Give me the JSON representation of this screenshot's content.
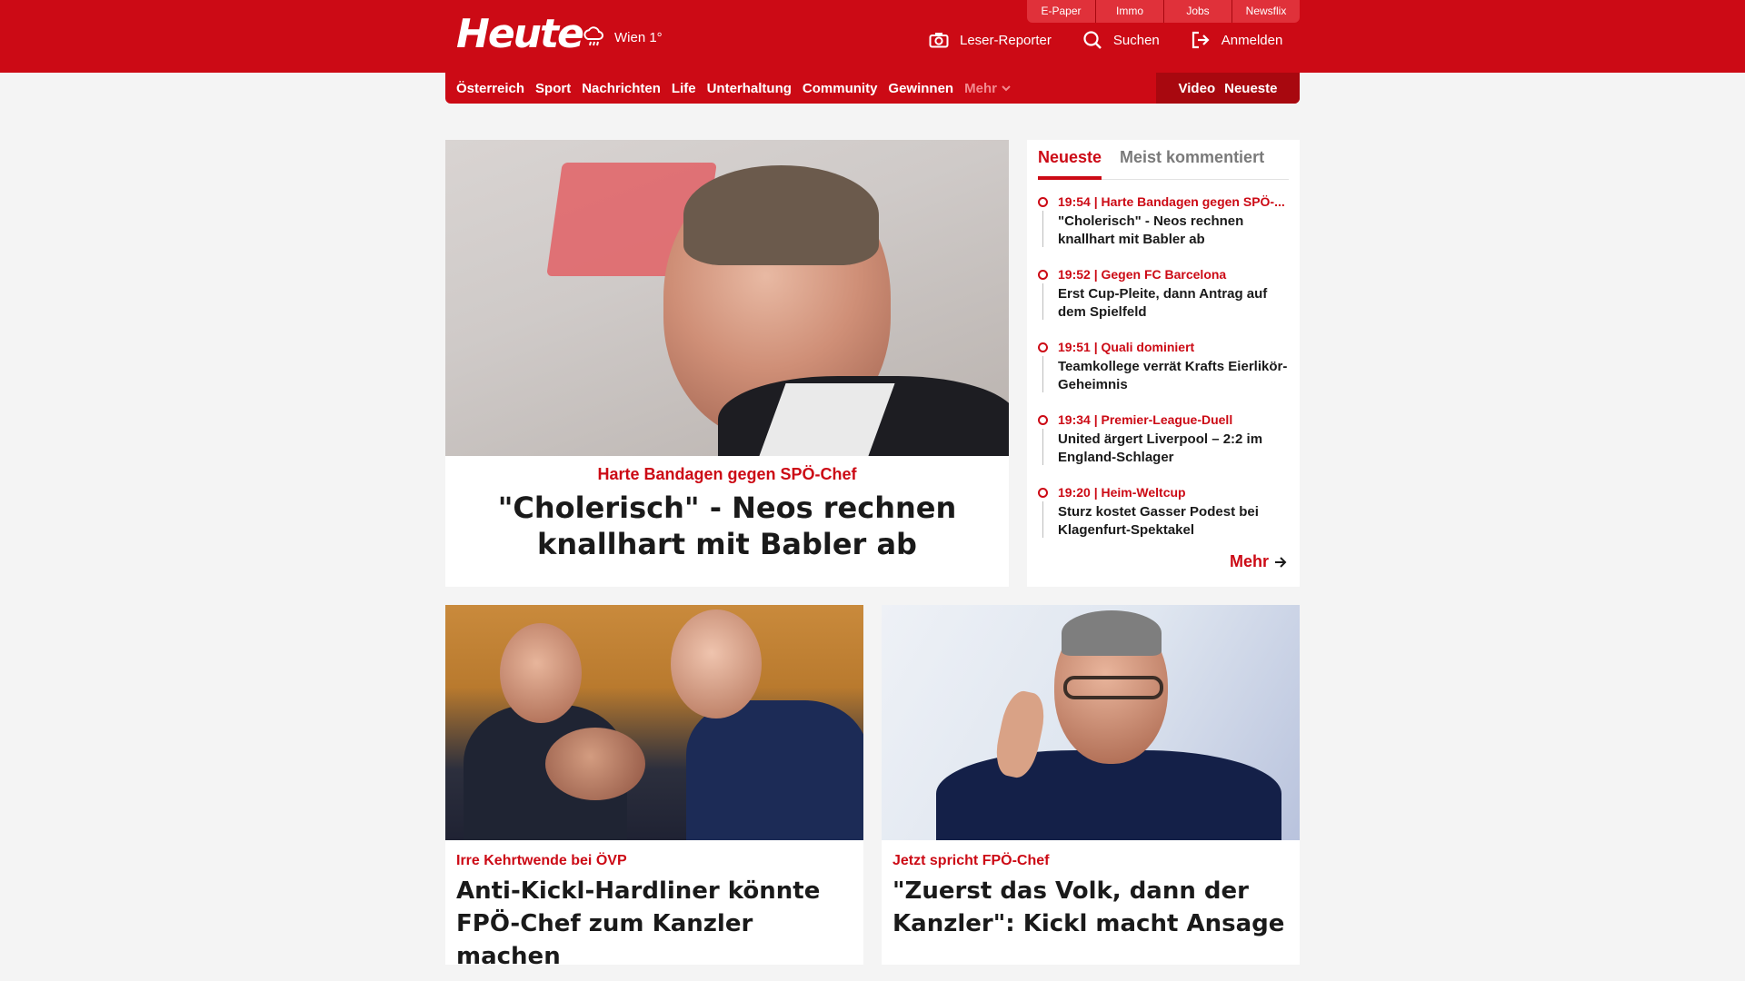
{
  "brand": {
    "logo": "Heute",
    "weather": "Wien 1°"
  },
  "toplinks": [
    "E-Paper",
    "Immo",
    "Jobs",
    "Newsflix"
  ],
  "header_actions": [
    {
      "label": "Leser-Reporter",
      "icon": "camera-icon"
    },
    {
      "label": "Suchen",
      "icon": "search-icon"
    },
    {
      "label": "Anmelden",
      "icon": "login-icon"
    }
  ],
  "nav": {
    "items": [
      "Österreich",
      "Sport",
      "Nachrichten",
      "Life",
      "Unterhaltung",
      "Community",
      "Gewinnen"
    ],
    "more": "Mehr",
    "right": [
      "Video",
      "Neueste"
    ]
  },
  "hero": {
    "kicker": "Harte Bandagen gegen SPÖ-Chef",
    "title": "\"Cholerisch\" - Neos rechnen knallhart mit Babler ab"
  },
  "sidebar": {
    "tabs": [
      "Neueste",
      "Meist kommentiert"
    ],
    "items": [
      {
        "meta": "19:54 | Harte Bandagen gegen SPÖ-...",
        "headline": "\"Cholerisch\" - Neos rechnen knallhart mit Babler ab"
      },
      {
        "meta": "19:52 | Gegen FC Barcelona",
        "headline": "Erst Cup-Pleite, dann Antrag auf dem Spielfeld"
      },
      {
        "meta": "19:51 | Quali dominiert",
        "headline": "Teamkollege verrät Krafts Eierlikör-Geheimnis"
      },
      {
        "meta": "19:34 | Premier-League-Duell",
        "headline": "United ärgert Liverpool – 2:2 im England-Schlager"
      },
      {
        "meta": "19:20 | Heim-Weltcup",
        "headline": "Sturz kostet Gasser Podest bei Klagenfurt-Spektakel"
      }
    ],
    "more": "Mehr"
  },
  "cards": [
    {
      "kicker": "Irre Kehrtwende bei ÖVP",
      "title": "Anti-Kickl-Hardliner könnte FPÖ-Chef zum Kanzler machen"
    },
    {
      "kicker": "Jetzt spricht FPÖ-Chef",
      "title": "\"Zuerst das Volk, dann der Kanzler\": Kickl macht Ansage"
    }
  ],
  "colors": {
    "brand_red": "#cc0a15",
    "dark_red": "#a8080f",
    "background": "#f4f4f4"
  }
}
